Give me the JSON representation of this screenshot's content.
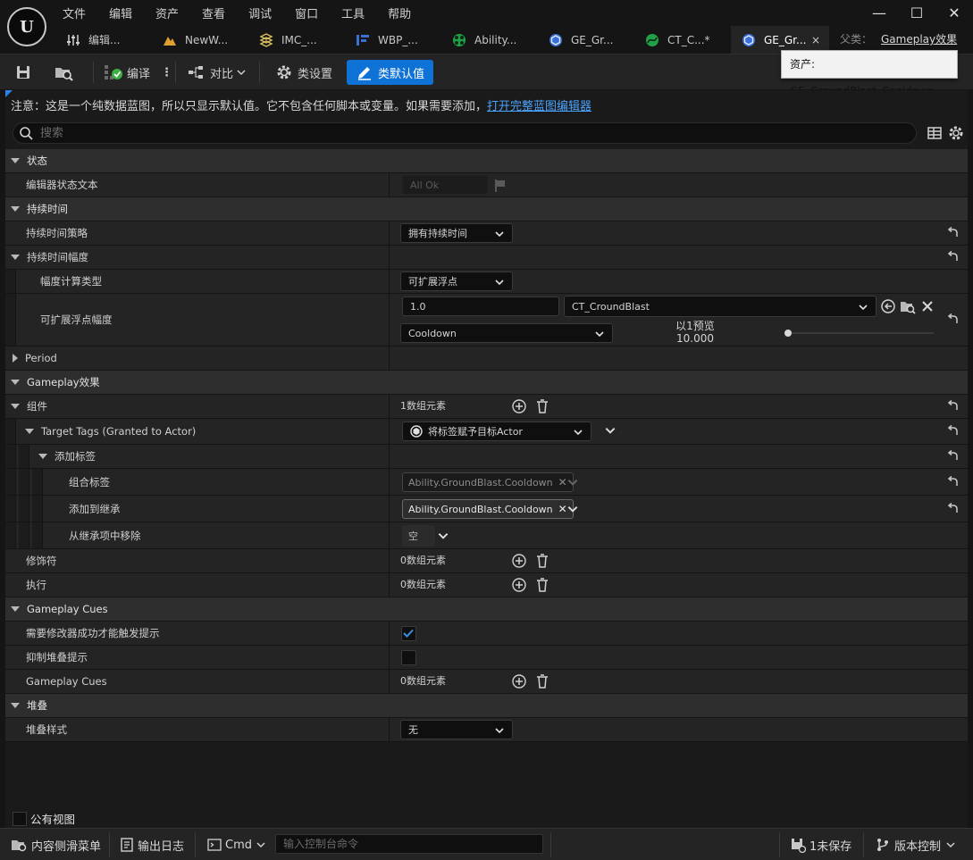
{
  "titlebar": {
    "menu": [
      "文件",
      "编辑",
      "资产",
      "查看",
      "调试",
      "窗口",
      "工具",
      "帮助"
    ],
    "tabs": [
      {
        "label": "编辑...",
        "icon": "sliders-icon"
      },
      {
        "label": "NewW...",
        "icon": "landscape-icon"
      },
      {
        "label": "IMC_...",
        "icon": "input-mapping-icon"
      },
      {
        "label": "WBP_...",
        "icon": "widget-blueprint-icon"
      },
      {
        "label": "Ability...",
        "icon": "ability-icon"
      },
      {
        "label": "GE_Gr...",
        "icon": "gameplay-effect-icon"
      },
      {
        "label": "CT_C...*",
        "icon": "curve-table-icon"
      },
      {
        "label": "GE_Gr...",
        "icon": "gameplay-effect-icon",
        "active": true,
        "close": "×"
      }
    ],
    "parent_label": "父类：",
    "parent_value": "Gameplay效果"
  },
  "toolbar": {
    "compile": "编译",
    "diff": "对比",
    "class_settings": "类设置",
    "class_defaults": "类默认值",
    "tooltip": "资产: GE_GroundBlast_Cooldown"
  },
  "notice": {
    "text": "注意：这是一个纯数据蓝图，所以只显示默认值。它不包含任何脚本或变量。如果需要添加，",
    "link": "打开完整蓝图编辑器"
  },
  "search": {
    "placeholder": "搜索"
  },
  "rows": {
    "status_cat": "状态",
    "editor_status_text": "编辑器状态文本",
    "editor_status_value": "All Ok",
    "duration_cat": "持续时间",
    "duration_policy": "持续时间策略",
    "duration_policy_value": "拥有持续时间",
    "duration_magnitude": "持续时间幅度",
    "magnitude_calc_type": "幅度计算类型",
    "magnitude_calc_value": "可扩展浮点",
    "scalable_float": "可扩展浮点幅度",
    "scalable_value": "1.0",
    "curve_table": "CT_CroundBlast",
    "curve_row": "Cooldown",
    "preview_label": "以1预览",
    "preview_value": "10.000",
    "preview_slider_fraction": 0.0,
    "period": "Period",
    "gameplay_effect_cat": "Gameplay效果",
    "components": "组件",
    "components_value": "1数组元素",
    "target_tags": "Target Tags (Granted to Actor)",
    "target_tags_value": "将标签赋予目标Actor",
    "add_tags": "添加标签",
    "combined_tags": "组合标签",
    "combined_tag_value": "Ability.GroundBlast.Cooldown",
    "added_to_inheritance": "添加到继承",
    "added_tag_value": "Ability.GroundBlast.Cooldown",
    "remove_from_inheritance": "从继承项中移除",
    "remove_value": "空",
    "modifiers": "修饰符",
    "modifiers_value": "0数组元素",
    "executions": "执行",
    "executions_value": "0数组元素",
    "gameplay_cues_cat": "Gameplay Cues",
    "require_modifier_success": "需要修改器成功才能触发提示",
    "require_modifier_checked": true,
    "suppress_stacking_cues": "抑制堆叠提示",
    "suppress_checked": false,
    "gameplay_cues": "Gameplay Cues",
    "gameplay_cues_value": "0数组元素",
    "stacking_cat": "堆叠",
    "stacking_type": "堆叠样式",
    "stacking_value": "无"
  },
  "public_view": "公有视图",
  "statusbar": {
    "content_drawer": "内容侧滑菜单",
    "output_log": "输出日志",
    "cmd": "Cmd",
    "console_placeholder": "输入控制台命令",
    "unsaved": "1未保存",
    "source_control": "版本控制"
  },
  "colors": {
    "accent": "#0e72d6",
    "link": "#4aa3ff",
    "checkbox": "#3a8ee6"
  }
}
